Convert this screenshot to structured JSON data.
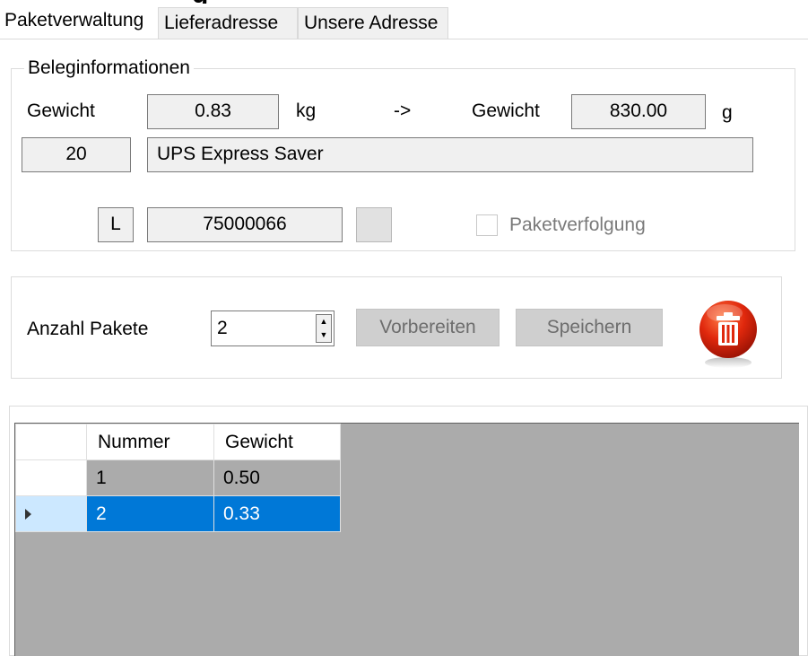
{
  "tabs": [
    {
      "label": "Paketverwaltung",
      "active": true
    },
    {
      "label": "Lieferadresse",
      "active": false
    },
    {
      "label": "Unsere Adresse",
      "active": false
    }
  ],
  "beleg": {
    "legend": "Beleginformationen",
    "weight_label": "Gewicht",
    "weight_value": "0.83",
    "weight_unit": "kg",
    "arrow": "->",
    "weight_g_label": "Gewicht",
    "weight_g_value": "830.00",
    "weight_g_unit": "g",
    "carrier_code": "20",
    "carrier_name": "UPS Express Saver",
    "prefix_code": "L",
    "beleg_number": "75000066",
    "tracking_label": "Paketverfolgung"
  },
  "packages": {
    "count_label": "Anzahl Pakete",
    "count_value": "2",
    "prepare_button": "Vorbereiten",
    "save_button": "Speichern",
    "delete_icon": "trash-icon"
  },
  "grid": {
    "columns": [
      "Nummer",
      "Gewicht"
    ],
    "rows": [
      {
        "nummer": "1",
        "gewicht": "0.50"
      },
      {
        "nummer": "2",
        "gewicht": "0.33"
      }
    ]
  },
  "colors": {
    "selection": "#0078d7",
    "trash_red": "#e0280d"
  }
}
